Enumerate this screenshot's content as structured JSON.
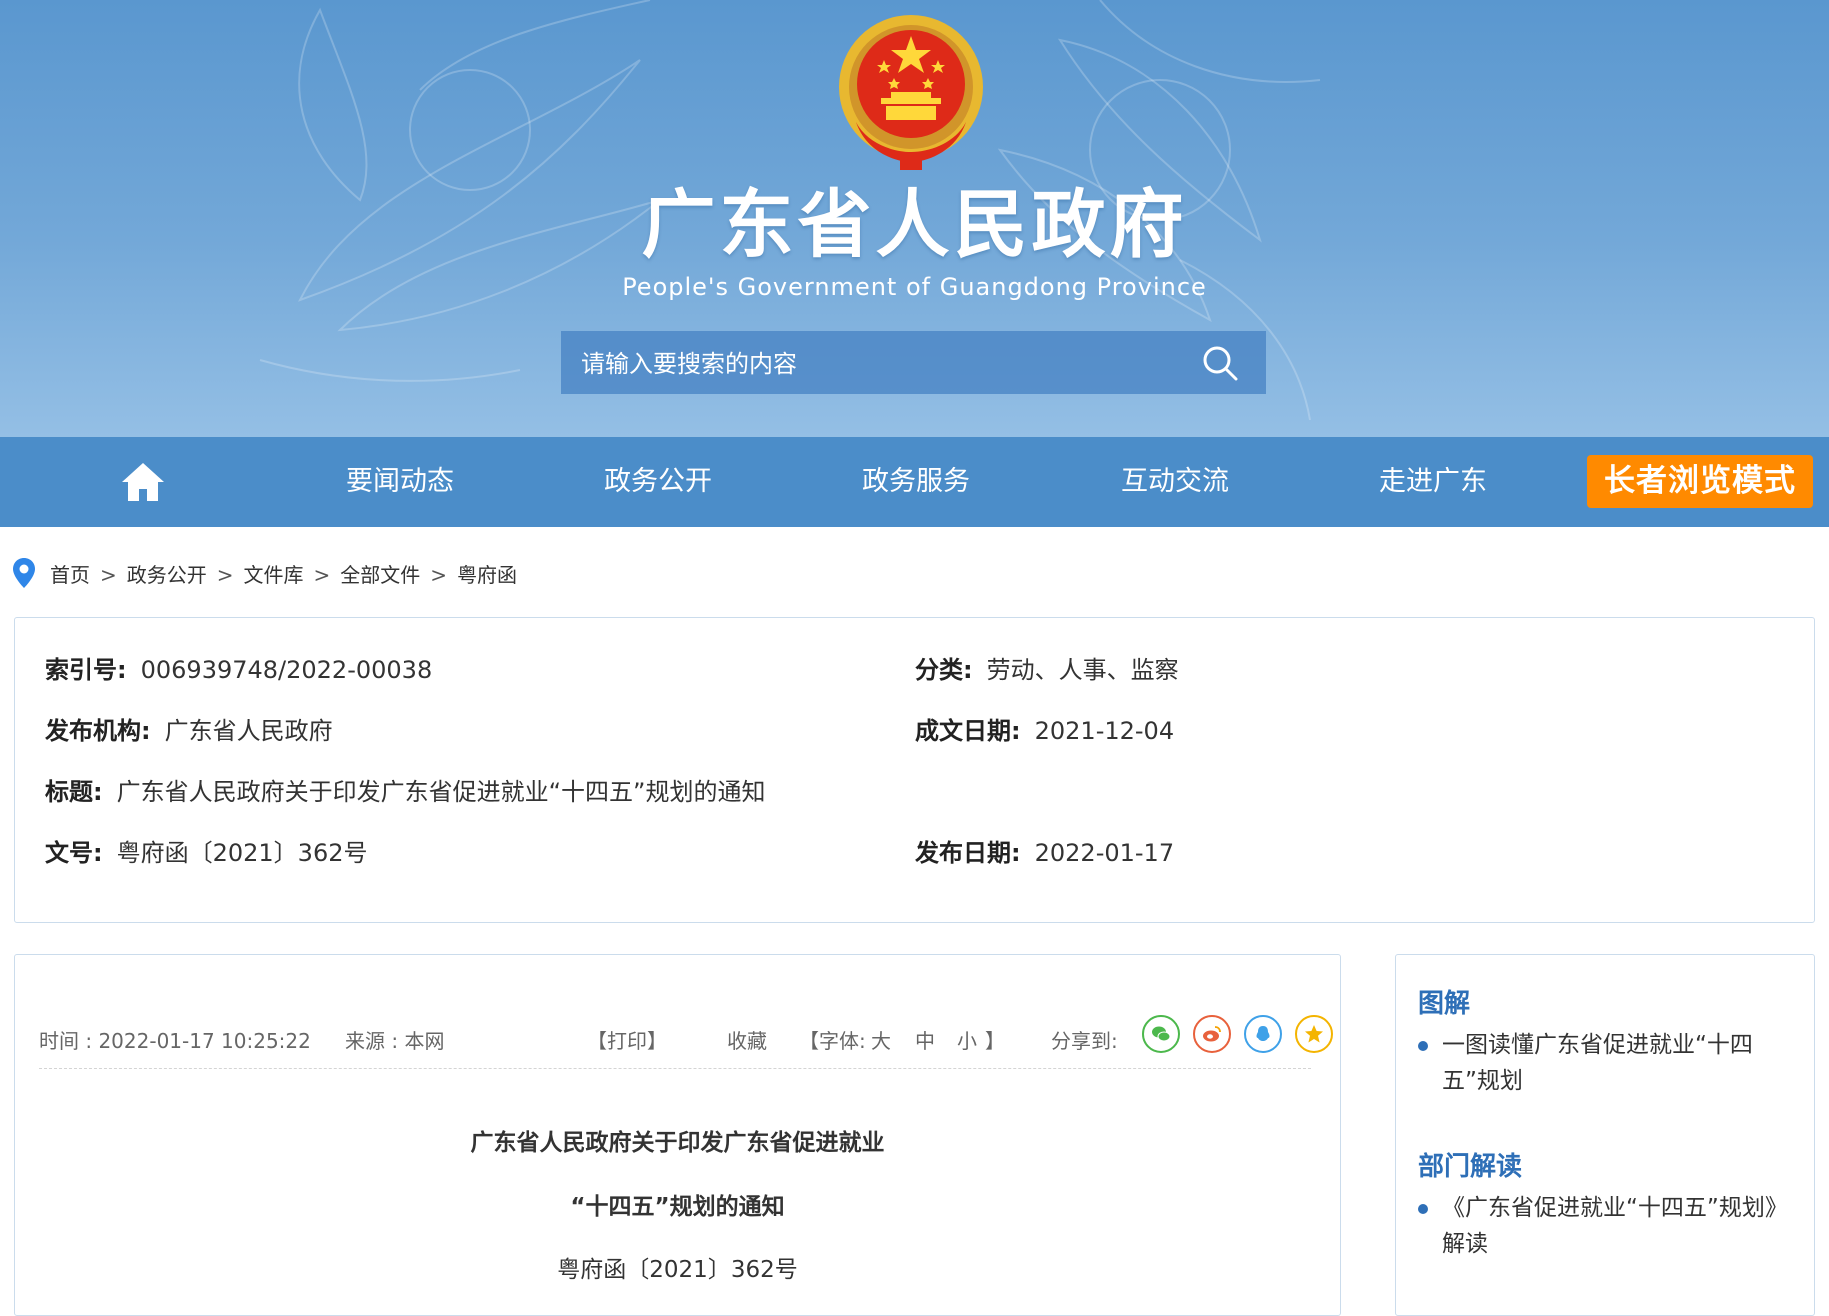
{
  "header": {
    "title": "广东省人民政府",
    "subtitle": "People's Government of Guangdong Province",
    "search_placeholder": "请输入要搜索的内容"
  },
  "nav": {
    "items": [
      "要闻动态",
      "政务公开",
      "政务服务",
      "互动交流",
      "走进广东"
    ],
    "elder_mode": "长者浏览模式"
  },
  "breadcrumb": [
    "首页",
    "政务公开",
    "文件库",
    "全部文件",
    "粤府函"
  ],
  "meta": {
    "index_label": "索引号:",
    "index_value": "006939748/2022-00038",
    "category_label": "分类:",
    "category_value": "劳动、人事、监察",
    "publisher_label": "发布机构:",
    "publisher_value": "广东省人民政府",
    "written_label": "成文日期:",
    "written_value": "2021-12-04",
    "title_label": "标题:",
    "title_value": "广东省人民政府关于印发广东省促进就业“十四五”规划的通知",
    "docno_label": "文号:",
    "docno_value": "粤府函〔2021〕362号",
    "pubdate_label": "发布日期:",
    "pubdate_value": "2022-01-17"
  },
  "toolbar": {
    "time": "时间 : 2022-01-17 10:25:22",
    "source": "来源 : 本网",
    "print": "【打印】",
    "favorite": "收藏",
    "font_label": "【字体:",
    "font_large": "大",
    "font_medium": "中",
    "font_small": "小",
    "font_end": "】",
    "share_label": "分享到:"
  },
  "article": {
    "title_line1": "广东省人民政府关于印发广东省促进就业",
    "title_line2": "“十四五”规划的通知",
    "doc_number": "粤府函〔2021〕362号"
  },
  "sidebar": {
    "section1_title": "图解",
    "section1_item": "一图读懂广东省促进就业“十四五”规划",
    "section2_title": "部门解读",
    "section2_item": "《广东省促进就业“十四五”规划》解读"
  },
  "colors": {
    "nav_bg": "#4b8dc9",
    "elder_bg": "#ff8a00",
    "accent": "#2e6fb7"
  }
}
